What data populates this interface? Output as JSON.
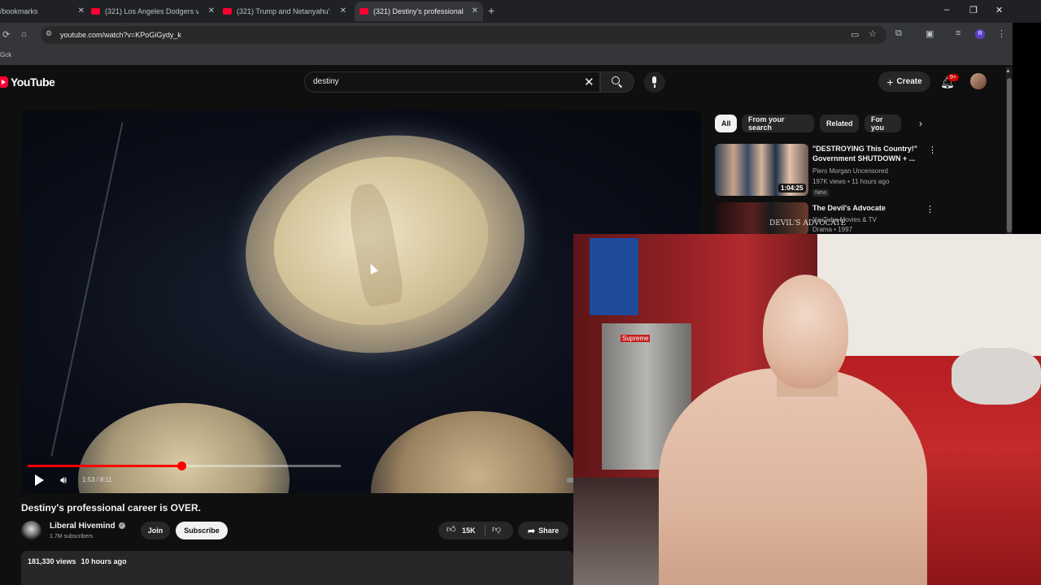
{
  "browser": {
    "tabs": [
      {
        "title": "/bookmarks",
        "active": false
      },
      {
        "title": "(321) Los Angeles Dodgers vs P",
        "active": false
      },
      {
        "title": "(321) Trump and Netanyahu's E",
        "active": false
      },
      {
        "title": "(321) Destiny's professional car",
        "active": true
      }
    ],
    "url": "youtube.com/watch?v=KPoGiGydy_k",
    "bookmark_item": "Gck",
    "new_tab_glyph": "+",
    "window_controls": {
      "minimize": "–",
      "maximize": "❐",
      "close": "✕"
    }
  },
  "youtube": {
    "logo_text": "YouTube",
    "search_value": "destiny",
    "create_label": "Create",
    "notification_count": "9+",
    "brand_color": "#ff0033"
  },
  "player": {
    "current_time": "1:53",
    "duration": "8:11",
    "played_fraction": 0.23,
    "buffered_fraction": 0.47
  },
  "video": {
    "title": "Destiny's professional career is OVER.",
    "channel": "Liberal Hivemind",
    "subscribers": "1.7M subscribers",
    "join_label": "Join",
    "subscribe_label": "Subscribe",
    "likes": "15K",
    "share_label": "Share",
    "views": "181,330 views",
    "uploaded": "10 hours ago"
  },
  "sidebar": {
    "chips": [
      "All",
      "From your search",
      "Related",
      "For you"
    ],
    "recommendations": [
      {
        "title": "\"DESTROYING This Country!\" Government SHUTDOWN + ...",
        "channel": "Piers Morgan Uncensored",
        "meta": "197K views • 11 hours ago",
        "badge": "New",
        "duration": "1:04:25"
      },
      {
        "title": "The Devil's Advocate",
        "channel": "YouTube Movies & TV",
        "meta": "Drama • 1997",
        "thumb_text": "DEVIL'S ADVOCATE"
      }
    ]
  },
  "overlay": {
    "description": "webcam",
    "label_box": "Supreme"
  }
}
